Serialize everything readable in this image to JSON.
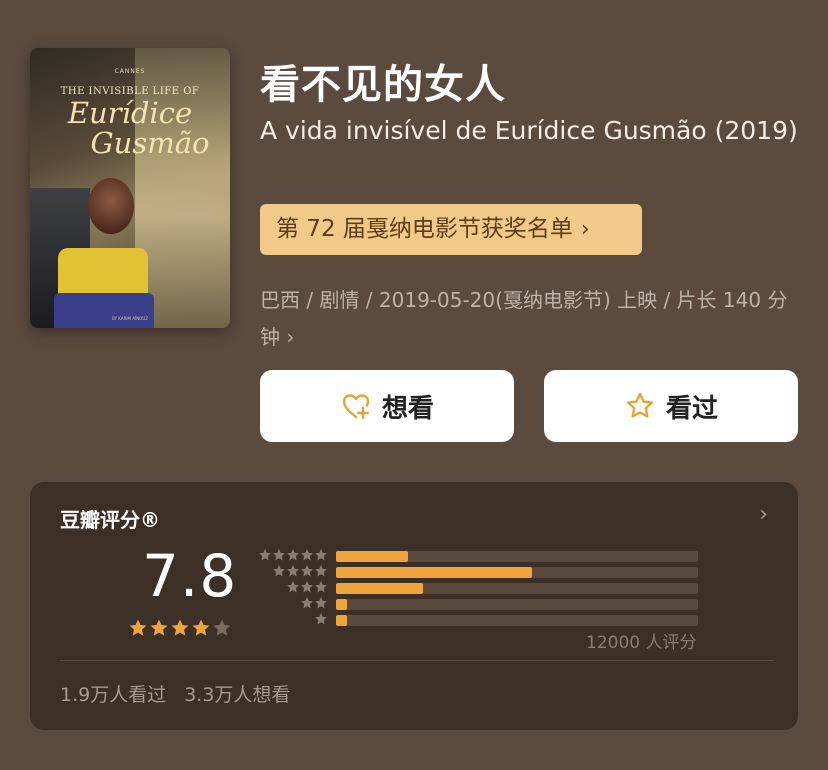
{
  "poster": {
    "laurel": "CANNES",
    "title_small": "THE INVISIBLE LIFE OF",
    "title_big_line1": "Eurídice",
    "title_big_line2": "Gusmão",
    "credits": "BY KARIM AÏNOUZ"
  },
  "movie": {
    "title_cn": "看不见的女人",
    "title_original": "A vida invisível de Eurídice Gusmão (2019)",
    "award_label": "第 72 届戛纳电影节获奖名单",
    "meta_line": "巴西 / 剧情 / 2019-05-20(戛纳电影节) 上映 / 片长 140 分钟",
    "meta_chevron": "›"
  },
  "buttons": {
    "want_label": "想看",
    "seen_label": "看过"
  },
  "rating": {
    "title": "豆瓣评分®",
    "chevron": "›",
    "score": "7.8",
    "stars_filled": 4,
    "distribution": [
      {
        "stars": 5,
        "fraction": 0.2
      },
      {
        "stars": 4,
        "fraction": 0.54
      },
      {
        "stars": 3,
        "fraction": 0.24
      },
      {
        "stars": 2,
        "fraction": 0.03
      },
      {
        "stars": 1,
        "fraction": 0.03
      }
    ],
    "votes_label": "12000 人评分",
    "seen_count": "1.9万人看过",
    "want_count": "3.3万人想看"
  },
  "colors": {
    "accent_orange": "#f0a43c",
    "award_bg": "#f2c988",
    "card_bg": "#3b2f26",
    "page_bg": "#5b4a3e"
  },
  "icons": {
    "want": "heart-plus-icon",
    "seen": "star-outline-icon"
  }
}
